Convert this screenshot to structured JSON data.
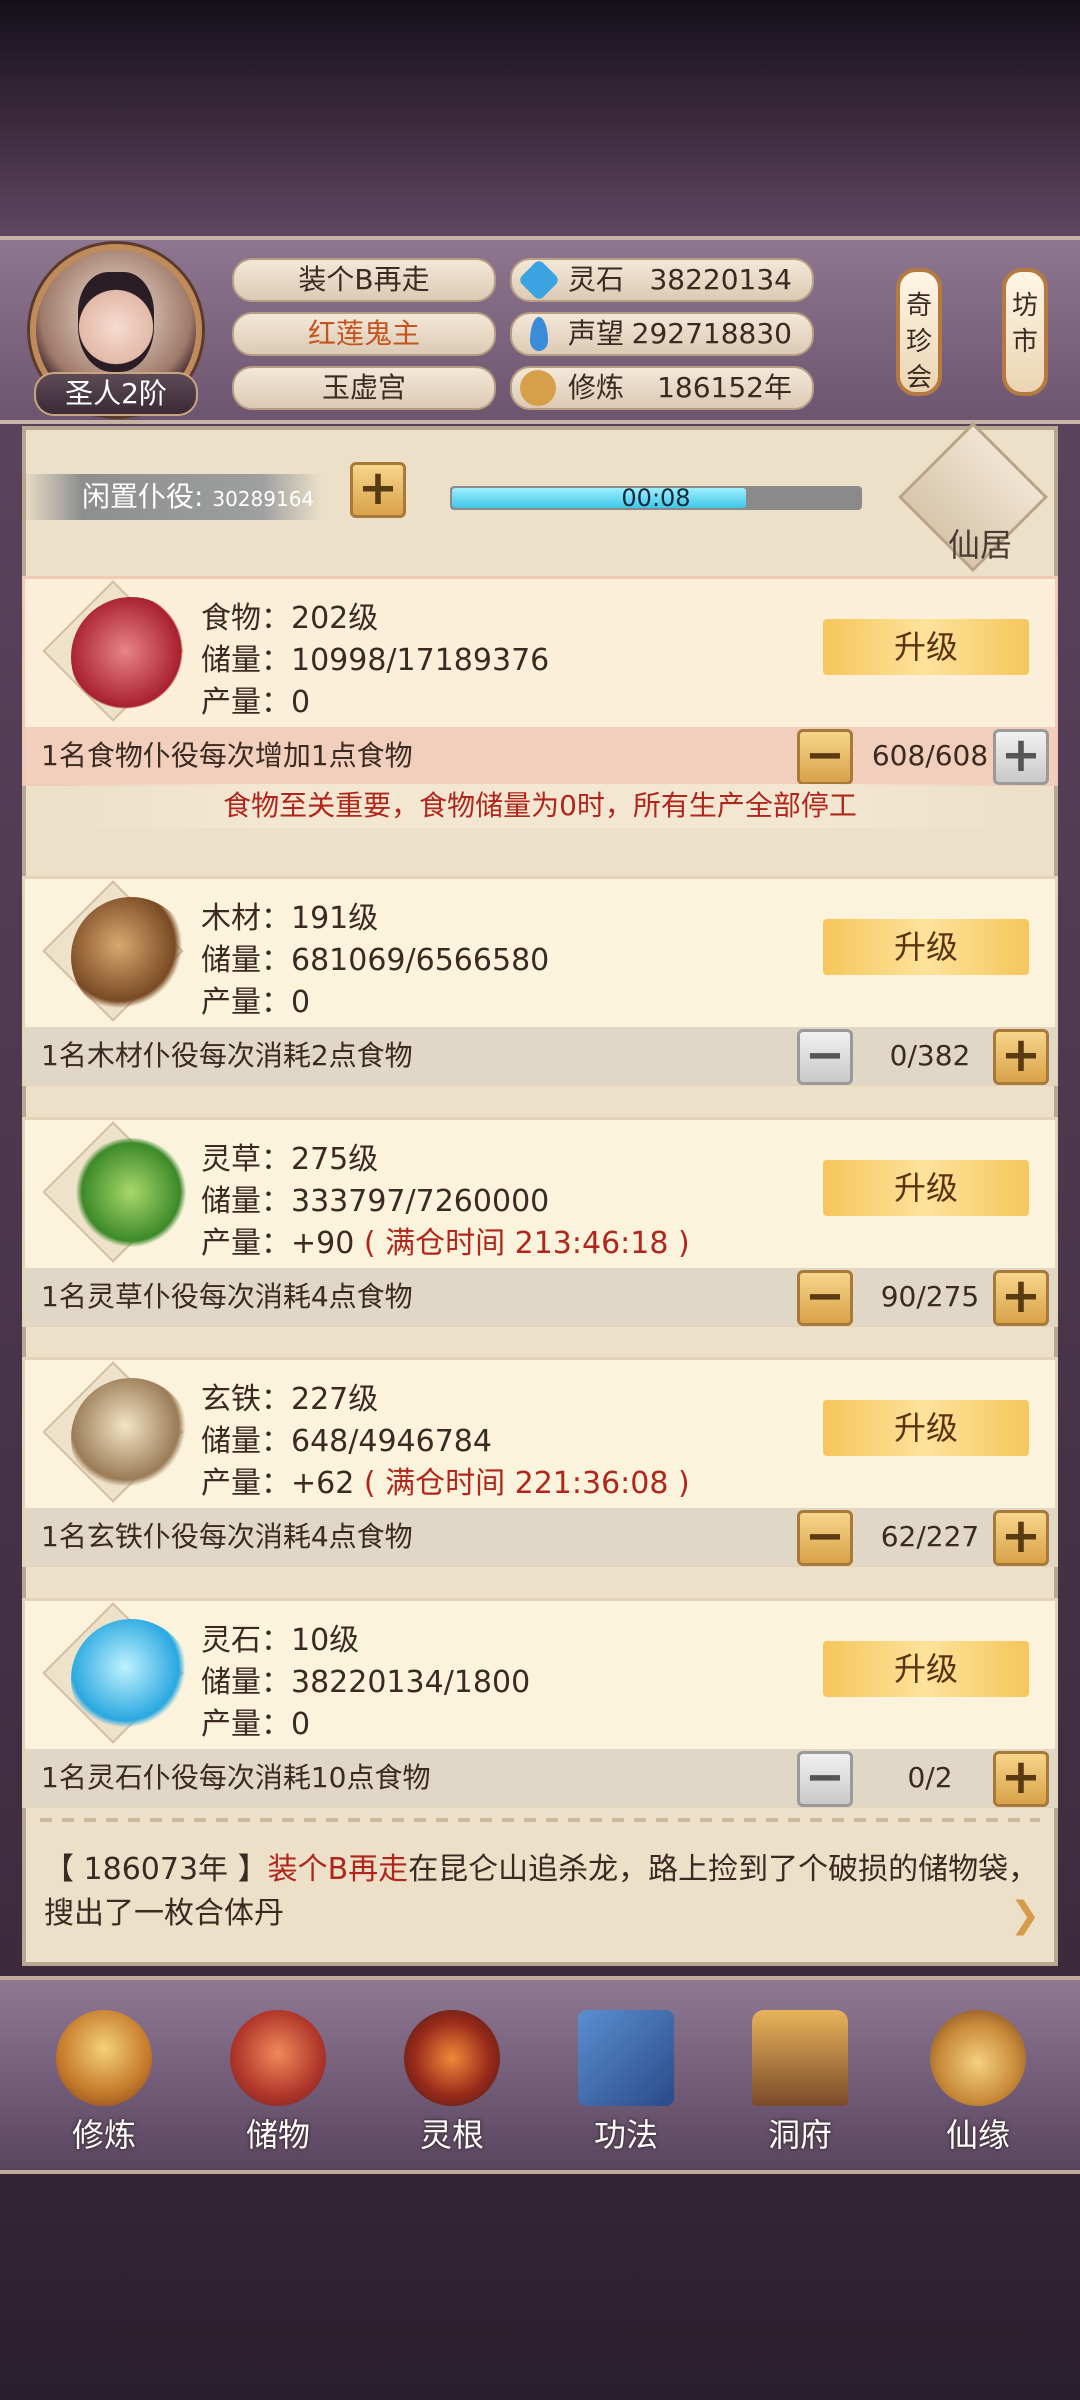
{
  "player": {
    "rank": "圣人2阶",
    "name": "装个B再走",
    "title": "红莲鬼主",
    "sect": "玉虚宫"
  },
  "stats": [
    {
      "label": "灵石",
      "value": "38220134",
      "icon": "spirit-stone-icon",
      "color": "#3aa3e0"
    },
    {
      "label": "声望",
      "value": "292718830",
      "icon": "fame-icon",
      "color": "#3a8cd8"
    },
    {
      "label": "修炼",
      "value": "186152年",
      "icon": "meditation-icon",
      "color": "#d6a04a"
    }
  ],
  "side_tags": [
    {
      "label": "奇珍会"
    },
    {
      "label": "坊市"
    }
  ],
  "idle": {
    "label": "闲置仆役",
    "count": "30289164",
    "timer": "00:08",
    "progress": 0.72
  },
  "xianju": {
    "label": "仙居"
  },
  "resources": [
    {
      "name": "食物：202级",
      "storage": "储量：10998/17189376",
      "output": "产量：0",
      "full_time": "",
      "desc": "1名食物仆役每次增加1点食物",
      "count": "608/608",
      "upgrade": "升级",
      "icon": "meat-icon"
    },
    {
      "name": "木材：191级",
      "storage": "储量：681069/6566580",
      "output": "产量：0",
      "full_time": "",
      "desc": "1名木材仆役每次消耗2点食物",
      "count": "0/382",
      "upgrade": "升级",
      "icon": "wood-icon"
    },
    {
      "name": "灵草：275级",
      "storage": "储量：333797/7260000",
      "output": "产量：+90",
      "full_time": "( 满仓时间 213:46:18 )",
      "desc": "1名灵草仆役每次消耗4点食物",
      "count": "90/275",
      "upgrade": "升级",
      "icon": "herb-icon"
    },
    {
      "name": "玄铁：227级",
      "storage": "储量：648/4946784",
      "output": "产量：+62",
      "full_time": "( 满仓时间 221:36:08 )",
      "desc": "1名玄铁仆役每次消耗4点食物",
      "count": "62/227",
      "upgrade": "升级",
      "icon": "iron-ore-icon"
    },
    {
      "name": "灵石：10级",
      "storage": "储量：38220134/1800",
      "output": "产量：0",
      "full_time": "",
      "desc": "1名灵石仆役每次消耗10点食物",
      "count": "0/2",
      "upgrade": "升级",
      "icon": "crystal-icon"
    }
  ],
  "warning": "食物至关重要，食物储量为0时，所有生产全部停工",
  "log": {
    "year": "【 186073年 】",
    "actor": "装个B再走",
    "text": "在昆仑山追杀龙，路上捡到了个破损的储物袋，搜出了一枚合体丹"
  },
  "nav": [
    {
      "label": "修炼",
      "icon": "cultivate-icon"
    },
    {
      "label": "储物",
      "icon": "storage-bag-icon"
    },
    {
      "label": "灵根",
      "icon": "spirit-root-icon"
    },
    {
      "label": "功法",
      "icon": "technique-book-icon"
    },
    {
      "label": "洞府",
      "icon": "cave-dwelling-icon"
    },
    {
      "label": "仙缘",
      "icon": "fate-gourd-icon"
    }
  ]
}
